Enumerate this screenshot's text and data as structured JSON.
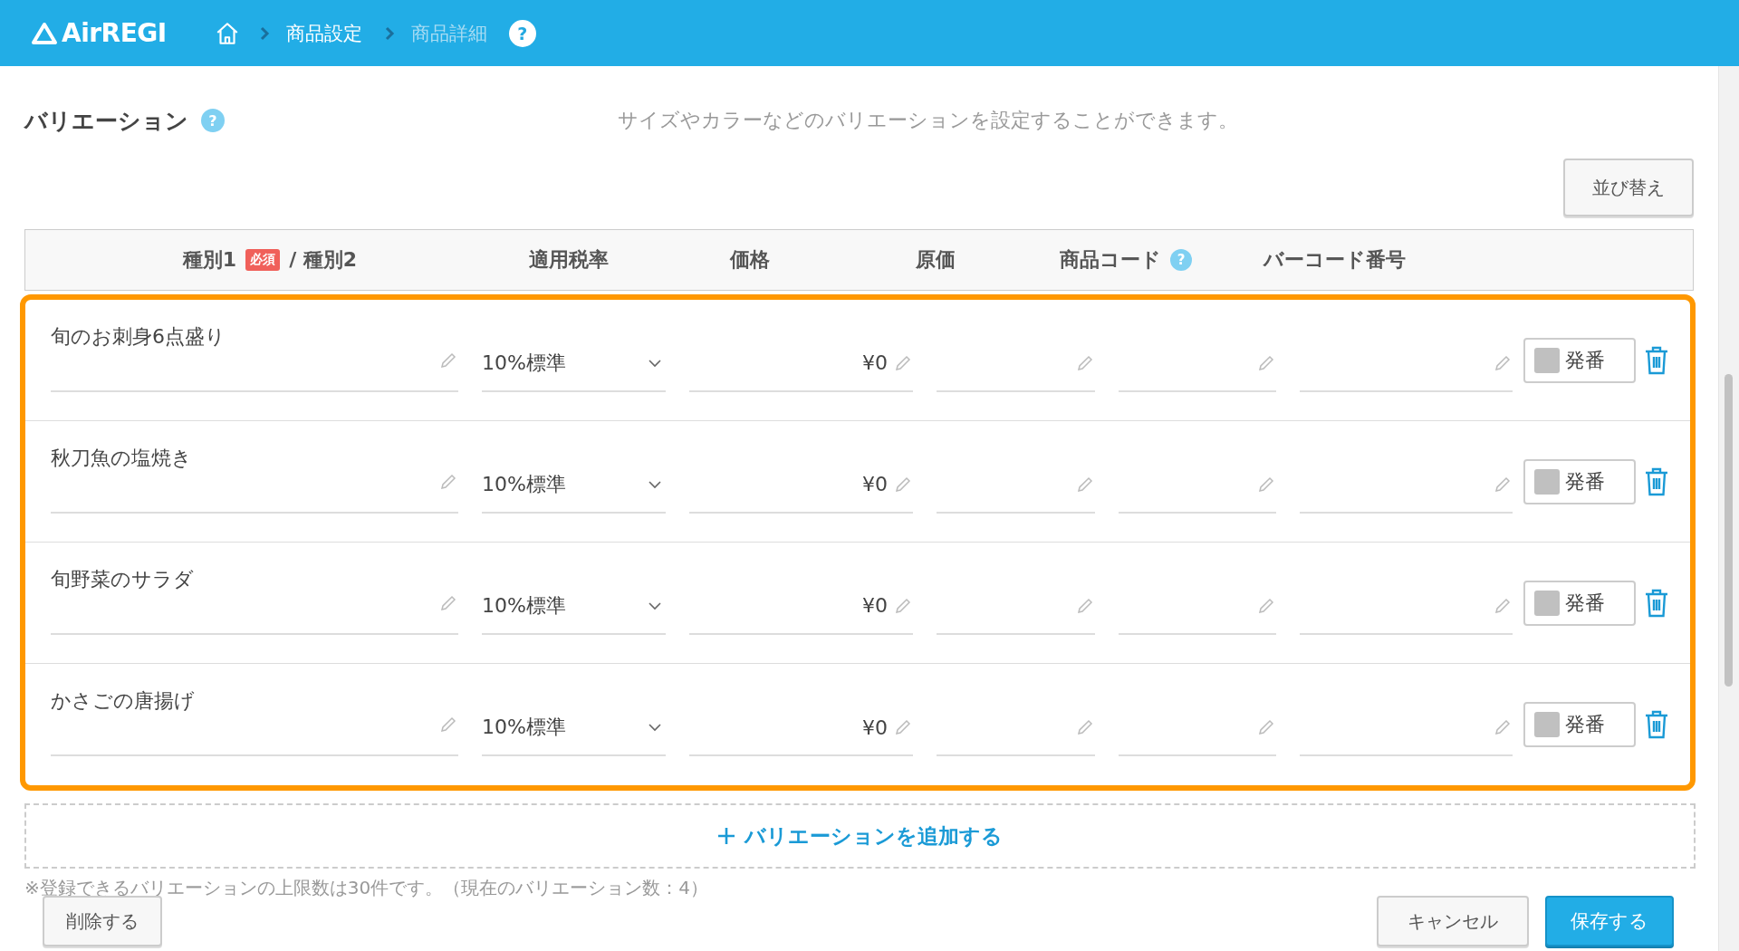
{
  "header": {
    "logo": "AirREGI",
    "help": "?",
    "breadcrumb": [
      {
        "label": "商品設定",
        "current": false
      },
      {
        "label": "商品詳細",
        "current": true
      }
    ]
  },
  "section": {
    "title": "バリエーション",
    "description": "サイズやカラーなどのバリエーションを設定することができます。",
    "sort_button": "並び替え",
    "help": "?"
  },
  "table": {
    "columns": [
      {
        "label": "種別1",
        "badge": "必須",
        "suffix": "/ 種別2"
      },
      {
        "label": "適用税率"
      },
      {
        "label": "価格"
      },
      {
        "label": "原価"
      },
      {
        "label": "商品コード",
        "help": "?"
      },
      {
        "label": "バーコード番号"
      }
    ],
    "rows": [
      {
        "name": "旬のお刺身6点盛り",
        "tax": "10%標準",
        "price": "¥0",
        "issue_button": "発番"
      },
      {
        "name": "秋刀魚の塩焼き",
        "tax": "10%標準",
        "price": "¥0",
        "issue_button": "発番"
      },
      {
        "name": "旬野菜のサラダ",
        "tax": "10%標準",
        "price": "¥0",
        "issue_button": "発番"
      },
      {
        "name": "かさごの唐揚げ",
        "tax": "10%標準",
        "price": "¥0",
        "issue_button": "発番"
      }
    ]
  },
  "add_button": "バリエーションを追加する",
  "note": "※登録できるバリエーションの上限数は30件です。（現在のバリエーション数：4）",
  "footer": {
    "delete_button": "削除する",
    "cancel_button": "キャンセル",
    "save_button": "保存する"
  }
}
